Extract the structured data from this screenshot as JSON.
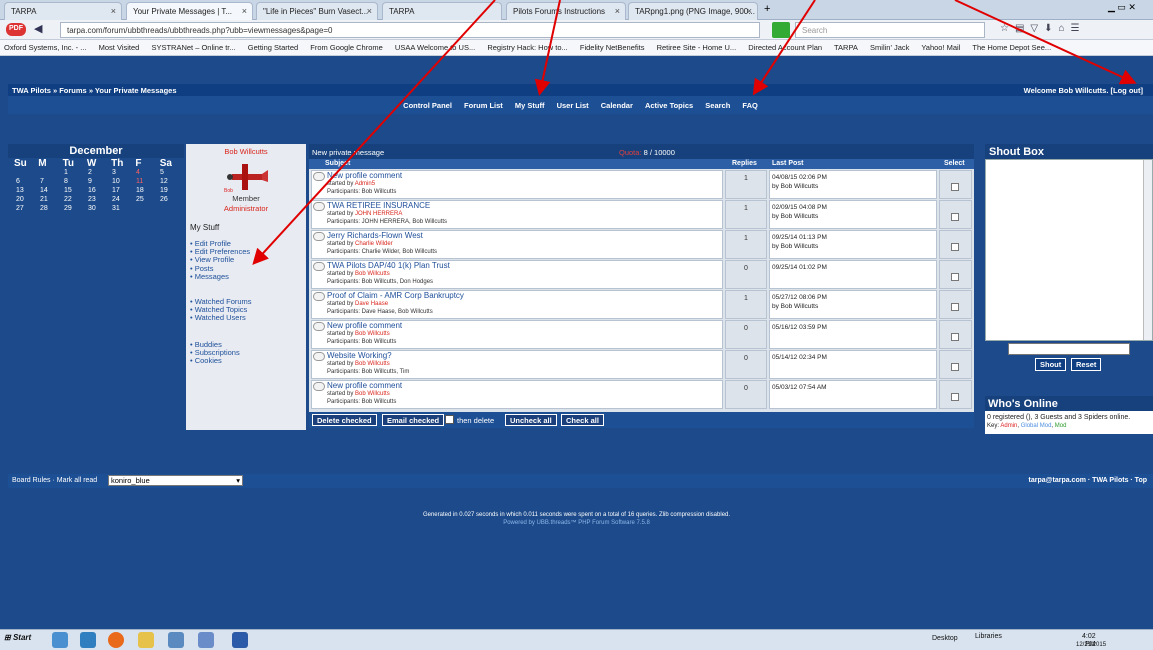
{
  "browser": {
    "tabs": [
      {
        "label": "TARPA"
      },
      {
        "label": "Your Private Messages | T..."
      },
      {
        "label": "\"Life in Pieces\" Burn Vasect..."
      },
      {
        "label": "TARPA"
      },
      {
        "label": "Pilots Forums Instructions"
      },
      {
        "label": "TARpng1.png (PNG Image, 900... "
      }
    ],
    "url": "tarpa.com/forum/ubbthreads/ubbthreads.php?ubb=viewmessages&page=0",
    "search_placeholder": "Search",
    "bookmarks": [
      "Oxford Systems, Inc. - ...",
      "Most Visited",
      "SYSTRANet – Online tr...",
      "Getting Started",
      "From Google Chrome",
      "USAA Welcome to US...",
      "Registry Hack: How to...",
      "Fidelity NetBenefits",
      "Retiree Site - Home U...",
      "Directed Account Plan",
      "TARPA",
      "Smilin' Jack",
      "Yahoo! Mail",
      "The Home Depot See..."
    ]
  },
  "forum": {
    "breadcrumb": "TWA Pilots » Forums » Your Private Messages",
    "welcome": "Welcome Bob Willcutts. [Log out]",
    "nav": [
      "Control Panel",
      "Forum List",
      "My Stuff",
      "User List",
      "Calendar",
      "Active Topics",
      "Search",
      "FAQ"
    ]
  },
  "calendar": {
    "month": "December",
    "days": [
      "Su",
      "M",
      "Tu",
      "W",
      "Th",
      "F",
      "Sa"
    ],
    "weeks": [
      [
        "",
        "",
        "1",
        "2",
        "3",
        "4",
        "5"
      ],
      [
        "6",
        "7",
        "8",
        "9",
        "10",
        "11",
        "12"
      ],
      [
        "13",
        "14",
        "15",
        "16",
        "17",
        "18",
        "19"
      ],
      [
        "20",
        "21",
        "22",
        "23",
        "24",
        "25",
        "26"
      ],
      [
        "27",
        "28",
        "29",
        "30",
        "31",
        "",
        ""
      ]
    ],
    "highlight_color": "#ff6060"
  },
  "profile": {
    "name": "Bob Willcutts",
    "role1": "Member",
    "role2": "Administrator",
    "mystuff_heading": "My Stuff",
    "menu1": [
      "• Edit Profile",
      "• Edit Preferences",
      "• View Profile",
      "• Posts",
      "• Messages"
    ],
    "menu2": [
      "• Watched Forums",
      "• Watched Topics",
      "• Watched Users"
    ],
    "menu3": [
      "• Buddies",
      "• Subscriptions",
      "• Cookies"
    ]
  },
  "pm": {
    "header": "New private message",
    "quota_label": "Quota:",
    "quota_value": "8 / 10000",
    "cols": {
      "subject": "Subject",
      "replies": "Replies",
      "last_post": "Last Post",
      "select": "Select"
    },
    "rows": [
      {
        "title": "New profile comment",
        "started_by": "Admin5",
        "participants": "Participants: Bob Willcutts",
        "replies": "1",
        "last_date": "04/08/15 02:06 PM",
        "last_by": "by Bob Willcutts"
      },
      {
        "title": "TWA RETIREE INSURANCE",
        "started_by": "JOHN HERRERA",
        "participants": "Participants: JOHN HERRERA, Bob Willcutts",
        "replies": "1",
        "last_date": "02/09/15 04:08 PM",
        "last_by": "by Bob Willcutts"
      },
      {
        "title": "Jerry Richards-Flown West",
        "started_by": "Charlie Wilder",
        "participants": "Participants: Charlie Wilder, Bob Willcutts",
        "replies": "1",
        "last_date": "09/25/14 01:13 PM",
        "last_by": "by Bob Willcutts"
      },
      {
        "title": "TWA Pilots DAP/40 1(k) Plan Trust",
        "started_by": "Bob Willcutts",
        "participants": "Participants: Bob Willcutts, Don Hodges",
        "replies": "0",
        "last_date": "09/25/14 01:02 PM",
        "last_by": ""
      },
      {
        "title": "Proof of Claim - AMR Corp Bankruptcy",
        "started_by": "Dave Haase",
        "participants": "Participants: Dave Haase, Bob Willcutts",
        "replies": "1",
        "last_date": "05/27/12 08:06 PM",
        "last_by": "by Bob Willcutts"
      },
      {
        "title": "New profile comment",
        "started_by": "Bob Willcutts",
        "participants": "Participants: Bob Willcutts",
        "replies": "0",
        "last_date": "05/16/12 03:59 PM",
        "last_by": ""
      },
      {
        "title": "Website Working?",
        "started_by": "Bob Willcutts",
        "participants": "Participants: Bob Willcutts, Tim",
        "replies": "0",
        "last_date": "05/14/12 02:34 PM",
        "last_by": ""
      },
      {
        "title": "New profile comment",
        "started_by": "Bob Willcutts",
        "participants": "Participants: Bob Willcutts",
        "replies": "0",
        "last_date": "05/03/12 07:54 AM",
        "last_by": ""
      }
    ],
    "started_prefix": "started by ",
    "buttons": {
      "delete": "Delete checked",
      "email": "Email checked",
      "then_delete": "then delete",
      "uncheck": "Uncheck all",
      "check": "Check all"
    }
  },
  "shoutbox": {
    "title": "Shout Box",
    "shout": "Shout",
    "reset": "Reset"
  },
  "whos_online": {
    "title": "Who's Online",
    "text": "0 registered (), 3 Guests and 3 Spiders online.",
    "key_label": "Key:",
    "key_admin": "Admin",
    "key_global": "Global Mod",
    "key_mod": "Mod"
  },
  "footer": {
    "board_rules": "Board Rules · Mark all read",
    "style": "koniro_blue",
    "right": "tarpa@tarpa.com · TWA Pilots · Top",
    "generated": "Generated in 0.027 seconds in which 0.011 seconds were spent on a total of 16 queries. Zlib compression disabled.",
    "powered": "Powered by UBB.threads™ PHP Forum Software 7.5.8"
  },
  "taskbar": {
    "start": "Start",
    "desktop": "Desktop",
    "libraries": "Libraries",
    "time": "4:02 PM",
    "date": "12/21/2015"
  }
}
